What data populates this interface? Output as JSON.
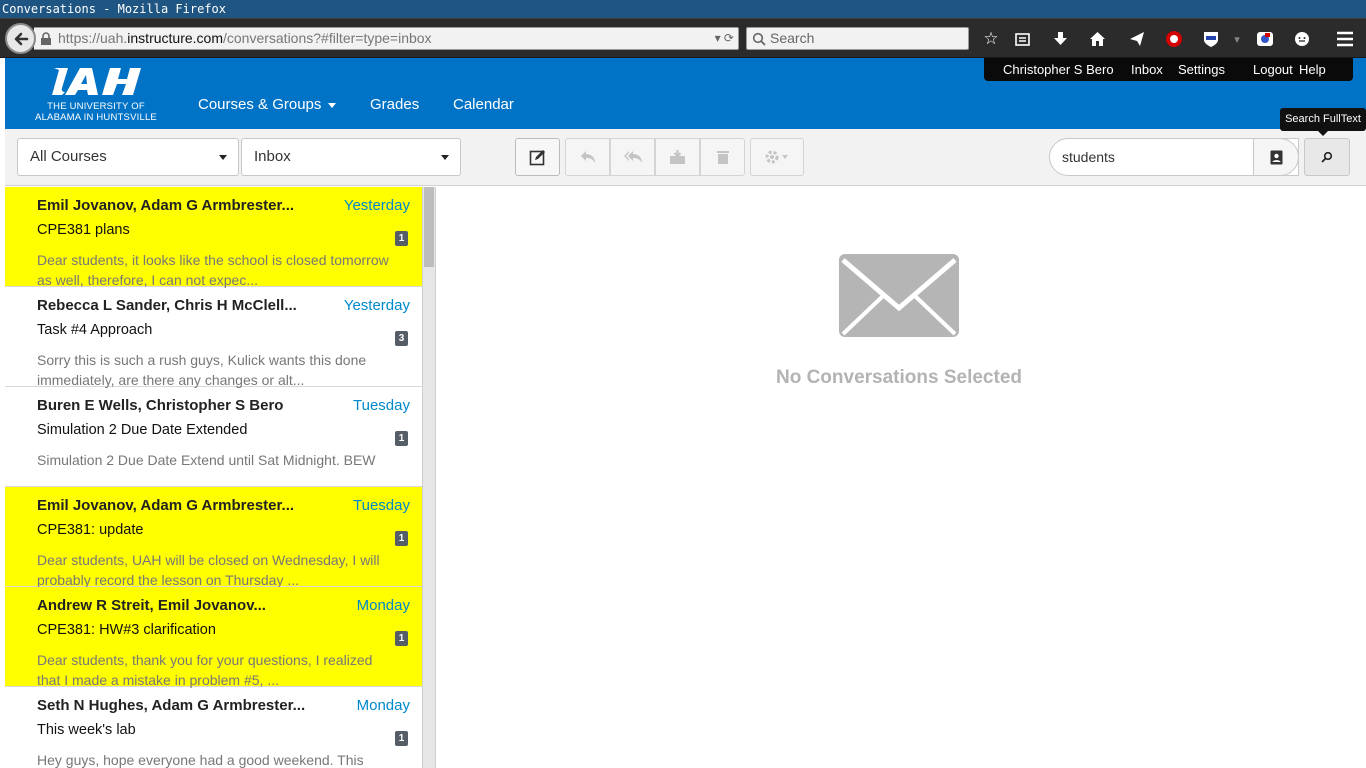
{
  "window": {
    "title": "Conversations - Mozilla Firefox"
  },
  "browser": {
    "url_prefix": "https://uah.",
    "url_host": "instructure.com",
    "url_path": "/conversations?#filter=type=inbox",
    "search_placeholder": "Search"
  },
  "header": {
    "logo_line1": "THE UNIVERSITY OF",
    "logo_line2": "ALABAMA IN HUNTSVILLE",
    "nav": {
      "courses": "Courses & Groups",
      "grades": "Grades",
      "calendar": "Calendar"
    },
    "user_menu": {
      "user": "Christopher S Bero",
      "inbox": "Inbox",
      "settings": "Settings",
      "logout": "Logout",
      "help": "Help"
    }
  },
  "toolbar": {
    "course_filter": "All Courses",
    "mailbox_filter": "Inbox",
    "search_value": "students",
    "tooltip": "Search FullText"
  },
  "messages": [
    {
      "from": "Emil Jovanov, Adam G Armbrester...",
      "date": "Yesterday",
      "subject": "CPE381 plans",
      "preview": "Dear students, it looks like the school is closed tomorrow as well, therefore, I can not expec...",
      "count": "1",
      "unread": true
    },
    {
      "from": "Rebecca L Sander, Chris H McClell...",
      "date": "Yesterday",
      "subject": "Task #4 Approach",
      "preview": "Sorry this is such a rush guys, Kulick wants this done immediately, are there any changes or alt...",
      "count": "3",
      "unread": false
    },
    {
      "from": "Buren E Wells, Christopher S Bero",
      "date": "Tuesday",
      "subject": "Simulation 2 Due Date Extended",
      "preview": "Simulation 2 Due Date Extend until Sat Midnight. BEW",
      "count": "1",
      "unread": false
    },
    {
      "from": "Emil Jovanov, Adam G Armbrester...",
      "date": "Tuesday",
      "subject": "CPE381: update",
      "preview": "Dear students, UAH will be closed on Wednesday, I will probably record the lesson on Thursday ...",
      "count": "1",
      "unread": true
    },
    {
      "from": "Andrew R Streit, Emil Jovanov...",
      "date": "Monday",
      "subject": "CPE381: HW#3 clarification",
      "preview": "Dear students, thank you for your questions, I realized that I made a mistake in problem #5, ...",
      "count": "1",
      "unread": true
    },
    {
      "from": "Seth N Hughes, Adam G Armbrester...",
      "date": "Monday",
      "subject": "This week's lab",
      "preview": "Hey guys, hope everyone had a good weekend. This",
      "count": "1",
      "unread": false
    }
  ],
  "empty_state": {
    "text": "No Conversations Selected"
  },
  "colors": {
    "brand": "#0073c6",
    "unread_highlight": "#ffff00",
    "date_link": "#0088cc"
  }
}
